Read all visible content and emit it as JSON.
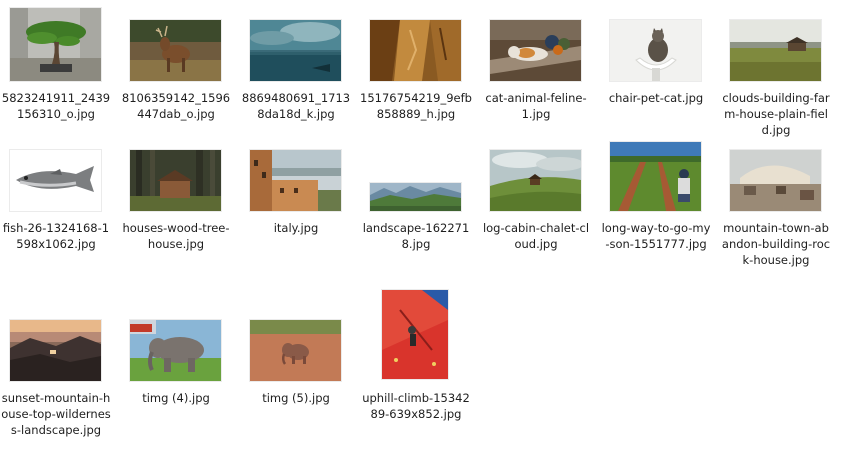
{
  "files": [
    {
      "name": "5823241911_2439156310_o.jpg",
      "icon": "bonsai-tree-photo-thumbnail"
    },
    {
      "name": "8106359142_1596447dab_o.jpg",
      "icon": "deer-photo-thumbnail"
    },
    {
      "name": "8869480691_17138da18d_k.jpg",
      "icon": "sea-clouds-photo-thumbnail"
    },
    {
      "name": "15176754219_9efb858889_h.jpg",
      "icon": "rock-cave-photo-thumbnail"
    },
    {
      "name": "cat-animal-feline-1.jpg",
      "icon": "cat-on-bench-photo-thumbnail"
    },
    {
      "name": "chair-pet-cat.jpg",
      "icon": "cat-on-chair-photo-thumbnail"
    },
    {
      "name": "clouds-building-farm-house-plain-field.jpg",
      "icon": "farm-field-photo-thumbnail"
    },
    {
      "name": "fish-26-1324168-1598x1062.jpg",
      "icon": "fish-photo-thumbnail"
    },
    {
      "name": "houses-wood-tree-house.jpg",
      "icon": "wood-house-forest-photo-thumbnail"
    },
    {
      "name": "italy.jpg",
      "icon": "italy-town-photo-thumbnail"
    },
    {
      "name": "landscape-1622718.jpg",
      "icon": "mountain-landscape-photo-thumbnail"
    },
    {
      "name": "log-cabin-chalet-cloud.jpg",
      "icon": "log-cabin-hill-photo-thumbnail"
    },
    {
      "name": "long-way-to-go-my-son-1551777.jpg",
      "icon": "child-on-field-photo-thumbnail"
    },
    {
      "name": "mountain-town-abandon-building-rock-house.jpg",
      "icon": "abandoned-town-photo-thumbnail"
    },
    {
      "name": "sunset-mountain-house-top-wilderness-landscape.jpg",
      "icon": "sunset-mountain-photo-thumbnail"
    },
    {
      "name": "timg (4).jpg",
      "icon": "elephant-photo-thumbnail"
    },
    {
      "name": "timg (5).jpg",
      "icon": "baby-elephant-photo-thumbnail"
    },
    {
      "name": "uphill-climb-1534289-639x852.jpg",
      "icon": "red-climbing-wall-photo-thumbnail"
    }
  ]
}
